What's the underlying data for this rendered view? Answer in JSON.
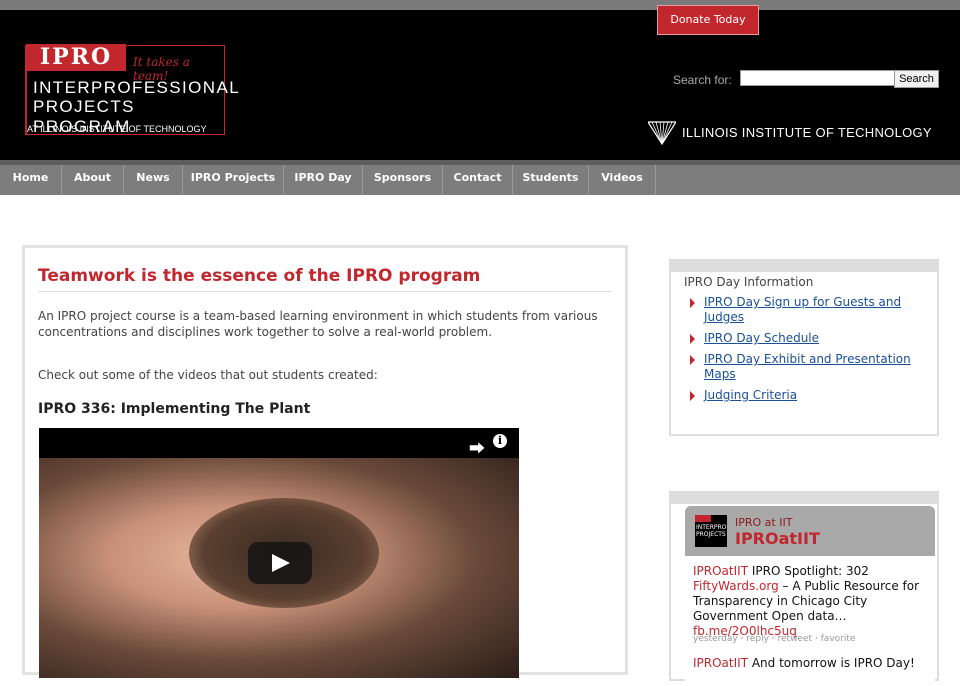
{
  "header": {
    "logo": {
      "badge": "IPRO",
      "tagline": "It takes a team!",
      "line1": "INTERPROFESSIONAL",
      "line2": "PROJECTS PROGRAM",
      "line3": "AT ILLINOIS INSTITUTE OF TECHNOLOGY"
    },
    "search": {
      "label": "Search for:",
      "value": "",
      "placeholder": "",
      "button": "Search"
    },
    "institution": "ILLINOIS INSTITUTE OF TECHNOLOGY"
  },
  "nav": {
    "items": [
      {
        "label": "Home"
      },
      {
        "label": "About"
      },
      {
        "label": "News"
      },
      {
        "label": "IPRO Projects"
      },
      {
        "label": "IPRO Day"
      },
      {
        "label": "Sponsors"
      },
      {
        "label": "Contact"
      },
      {
        "label": "Students"
      },
      {
        "label": "Videos"
      }
    ],
    "donate": "Donate Today"
  },
  "main": {
    "title": "Teamwork is the essence of the IPRO program",
    "intro": "An IPRO project course is a team-based learning environment in which students from various concentrations and disciplines work together to solve a real-world problem.",
    "videos_intro": "Check out some of the videos that out students created:",
    "video_title": "IPRO 336: Implementing The Plant"
  },
  "sidebar": {
    "ipro_day": {
      "title": "IPRO Day Information",
      "links": [
        {
          "label": "IPRO Day Sign up for Guests and Judges"
        },
        {
          "label": "IPRO Day Schedule"
        },
        {
          "label": "IPRO Day Exhibit and Presentation Maps"
        },
        {
          "label": "Judging Criteria"
        }
      ]
    },
    "twitter": {
      "name": "IPRO at IIT",
      "handle": "IPROatIIT",
      "tweet1": {
        "user": "IPROatIIT",
        "text_a": " IPRO Spotlight: 302 ",
        "link_a": "FiftyWards.org",
        "text_b": " – A Public Resource for Transparency in Chicago City Government Open data… ",
        "link_b": "fb.me/2O0lhc5uq",
        "meta_time": "yesterday",
        "meta_reply": "reply",
        "meta_retweet": "retweet",
        "meta_favorite": "favorite"
      },
      "tweet2": {
        "user": "IPROatIIT",
        "text": " And tomorrow is IPRO Day!"
      }
    }
  },
  "colors": {
    "brand_red": "#c1272d",
    "nav_gray": "#7d7d7d",
    "link_blue": "#1a4f9a"
  }
}
